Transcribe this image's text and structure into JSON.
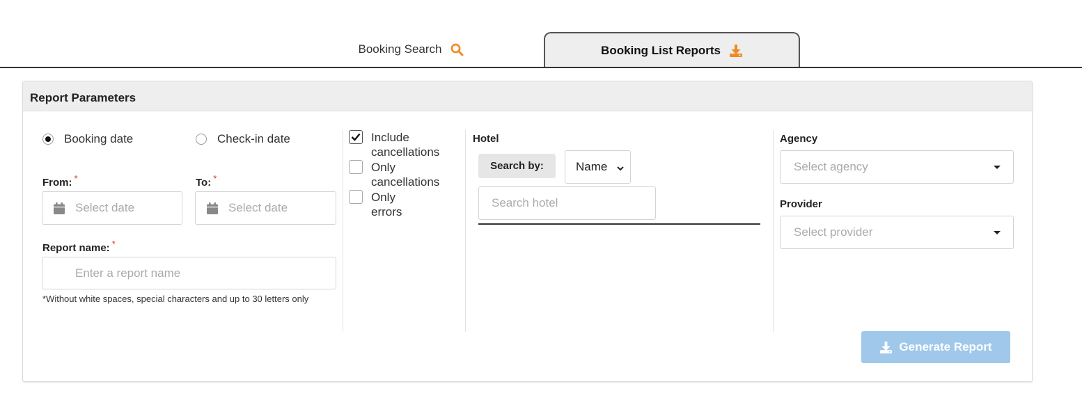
{
  "tabs": {
    "search_label": "Booking Search",
    "reports_label": "Booking List Reports"
  },
  "panel": {
    "title": "Report Parameters"
  },
  "date_type": {
    "booking_label": "Booking date",
    "checkin_label": "Check-in date",
    "selected": "booking"
  },
  "from": {
    "label": "From:",
    "placeholder": "Select date"
  },
  "to": {
    "label": "To:",
    "placeholder": "Select date"
  },
  "report_name": {
    "label": "Report name:",
    "placeholder": "Enter a report name",
    "hint": "*Without white spaces, special characters and up to 30 letters only"
  },
  "required_mark": "*",
  "options": {
    "include_cancellations": {
      "line1": "Include",
      "line2": "cancellations",
      "checked": true
    },
    "only_cancellations": {
      "line1": "Only",
      "line2": "cancellations",
      "checked": false
    },
    "only_errors": {
      "line1": "Only",
      "line2": "errors",
      "checked": false
    }
  },
  "hotel": {
    "label": "Hotel",
    "search_by_label": "Search by:",
    "search_by_value": "Name",
    "search_placeholder": "Search hotel"
  },
  "agency": {
    "label": "Agency",
    "placeholder": "Select agency"
  },
  "provider": {
    "label": "Provider",
    "placeholder": "Select provider"
  },
  "generate_button": "Generate Report",
  "colors": {
    "accent": "#f08a24",
    "required": "#d9342b",
    "button_disabled": "#9fc8ea",
    "header_bg": "#eeeeee"
  }
}
